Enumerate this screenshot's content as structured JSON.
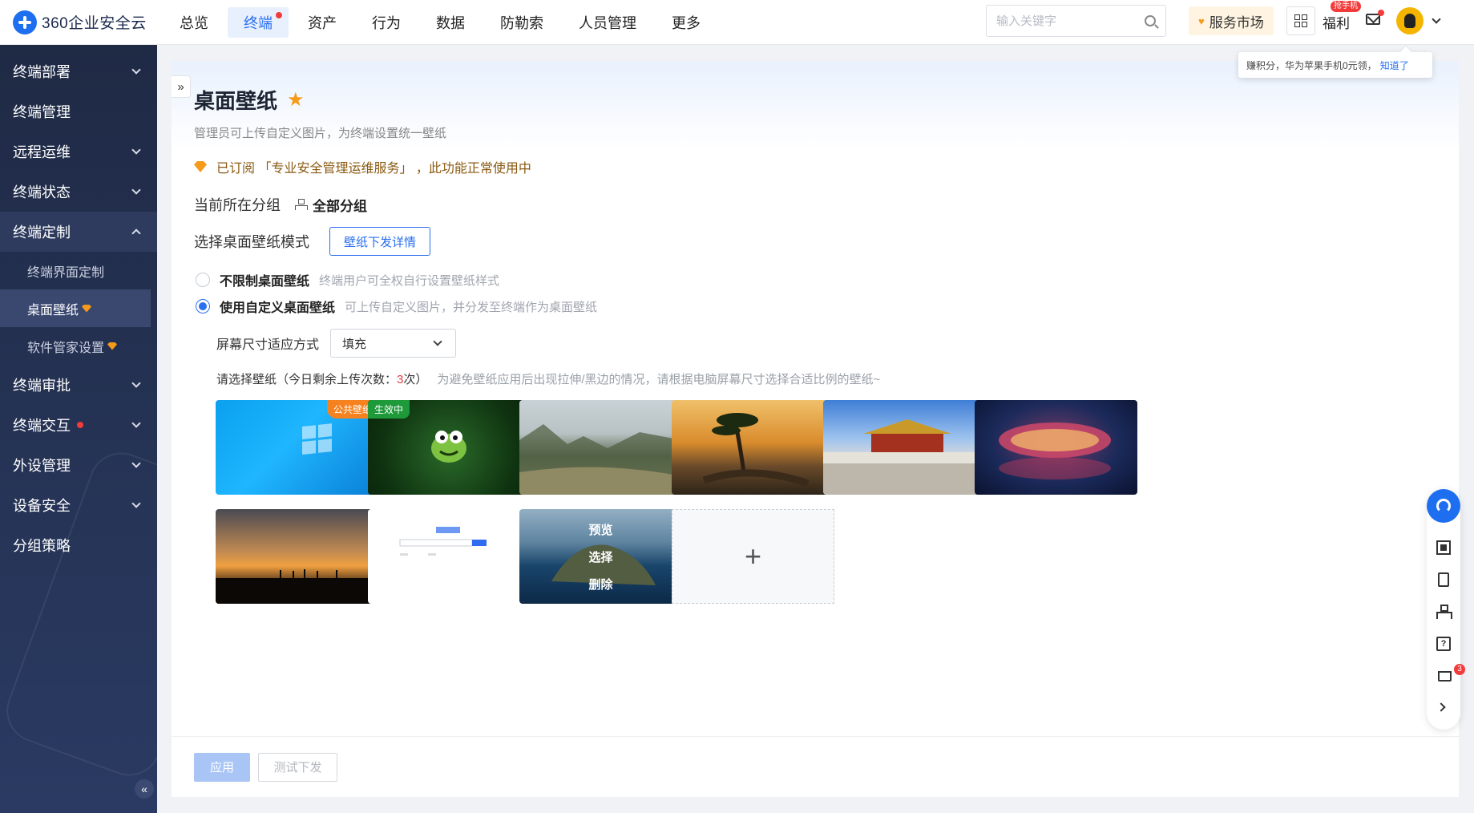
{
  "app": {
    "name": "360企业安全云"
  },
  "nav": [
    {
      "label": "总览"
    },
    {
      "label": "终端"
    },
    {
      "label": "资产"
    },
    {
      "label": "行为"
    },
    {
      "label": "数据"
    },
    {
      "label": "防勒索"
    },
    {
      "label": "人员管理"
    },
    {
      "label": "更多"
    }
  ],
  "header": {
    "search_placeholder": "输入关键字",
    "market_label": "服务市场",
    "fuli_label": "福利",
    "fuli_tag": "抢手机",
    "avatar_text": "Linux",
    "tooltip_text": "赚积分，华为苹果手机0元领，",
    "tooltip_link": "知道了"
  },
  "sidebar": {
    "items": [
      {
        "label": "终端部署"
      },
      {
        "label": "终端管理"
      },
      {
        "label": "远程运维"
      },
      {
        "label": "终端状态"
      },
      {
        "label": "终端定制"
      },
      {
        "label": "终端审批"
      },
      {
        "label": "终端交互"
      },
      {
        "label": "外设管理"
      },
      {
        "label": "设备安全"
      },
      {
        "label": "分组策略"
      }
    ],
    "sub_items": [
      {
        "label": "终端界面定制"
      },
      {
        "label": "桌面壁纸"
      },
      {
        "label": "软件管家设置"
      }
    ],
    "collapse_glyph": "«"
  },
  "page": {
    "expand_glyph": "»",
    "title": "桌面壁纸",
    "description": "管理员可上传自定义图片，为终端设置统一壁纸",
    "subscription_text": "已订阅 「专业安全管理运维服务」 ，此功能正常使用中",
    "group_label": "当前所在分组",
    "group_value": "全部分组",
    "mode_label": "选择桌面壁纸模式",
    "detail_button": "壁纸下发详情",
    "option_unlimited": "不限制桌面壁纸",
    "option_unlimited_desc": "终端用户可全权自行设置壁纸样式",
    "option_custom": "使用自定义桌面壁纸",
    "option_custom_desc": "可上传自定义图片，并分发至终端作为桌面壁纸",
    "fit_label": "屏幕尺寸适应方式",
    "fit_value": "填充",
    "hint_prefix": "请选择壁纸（今日剩余上传次数：",
    "hint_count": "3",
    "hint_suffix": "次）",
    "hint_gray": "为避免壁纸应用后出现拉伸/黑边的情况，请根据电脑屏幕尺寸选择合适比例的壁纸~",
    "public_tag": "公共壁纸",
    "active_tag": "生效中",
    "hover_preview": "预览",
    "hover_select": "选择",
    "hover_delete": "删除",
    "add_glyph": "+",
    "apply_button": "应用",
    "test_button": "测试下发"
  },
  "floatbar": {
    "cart_count": "3"
  }
}
